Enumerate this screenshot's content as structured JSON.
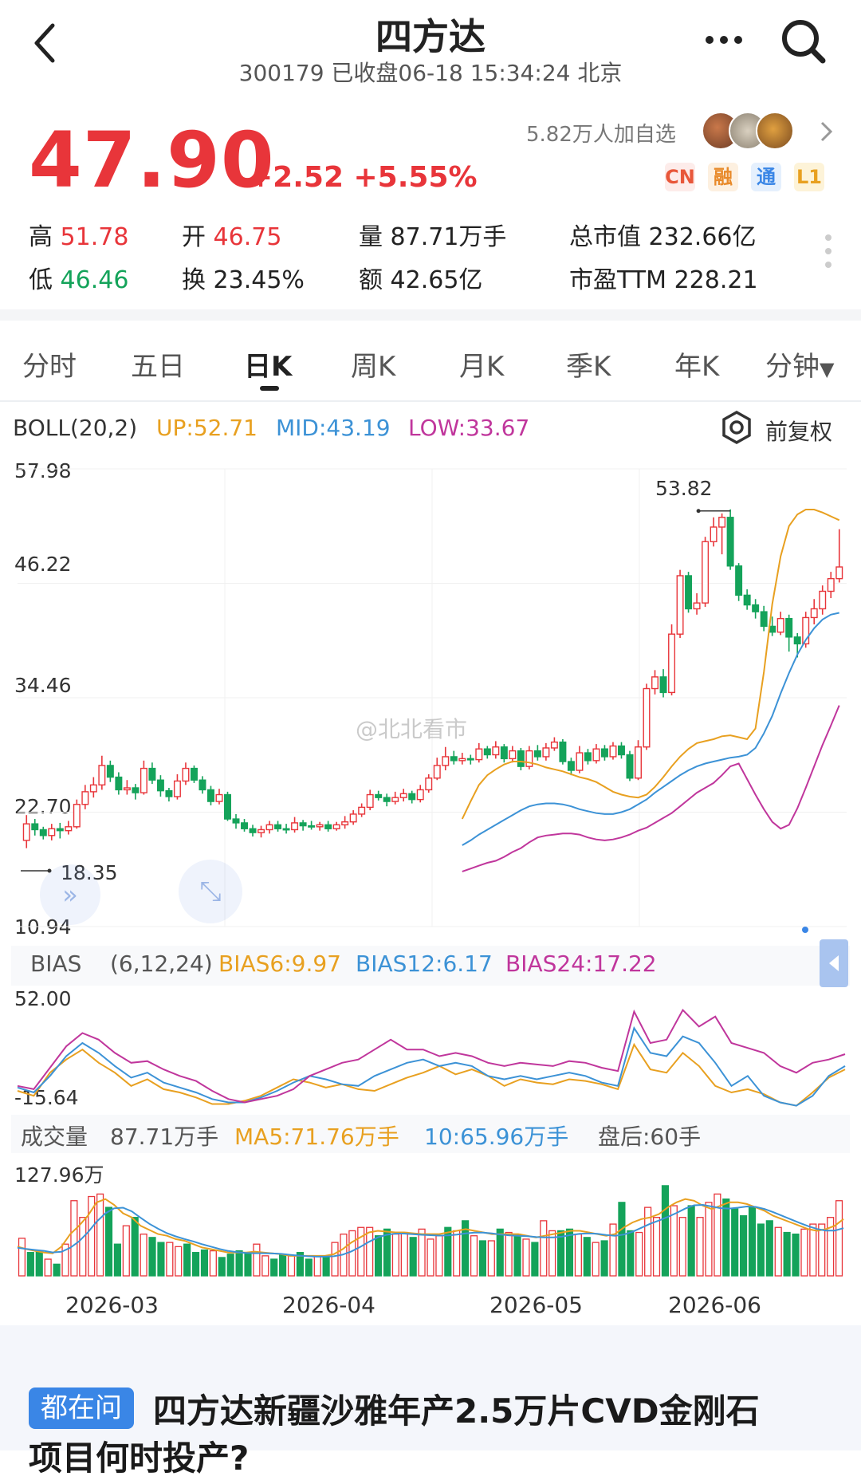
{
  "header": {
    "title": "四方达",
    "subtitle": "300179 已收盘06-18 15:34:24 北京"
  },
  "quote": {
    "price": "47.90",
    "change": "+2.52 +5.55%",
    "followers": "5.82万人加自选",
    "badges": [
      "CN",
      "融",
      "通",
      "L1"
    ],
    "stats": {
      "high_label": "高",
      "high": "51.78",
      "low_label": "低",
      "low": "46.46",
      "open_label": "开",
      "open": "46.75",
      "turnover_label": "换",
      "turnover": "23.45%",
      "volume_label": "量",
      "volume": "87.71万手",
      "amount_label": "额",
      "amount": "42.65亿",
      "mktcap_label": "总市值",
      "mktcap": "232.66亿",
      "pe_label": "市盈TTM",
      "pe": "228.21"
    }
  },
  "tabs": [
    {
      "label": "分时"
    },
    {
      "label": "五日"
    },
    {
      "label": "日K"
    },
    {
      "label": "周K"
    },
    {
      "label": "月K"
    },
    {
      "label": "季K"
    },
    {
      "label": "年K"
    },
    {
      "label": "分钟"
    }
  ],
  "boll": {
    "name": "BOLL(20,2)",
    "up": "UP:52.71",
    "mid": "MID:43.19",
    "low": "LOW:33.67",
    "adjust": "前复权"
  },
  "price_axis": [
    "57.98",
    "46.22",
    "34.46",
    "22.70",
    "10.94"
  ],
  "markers": {
    "high": "53.82",
    "low": "18.35"
  },
  "watermark": "@北北看市",
  "bias": {
    "name": "BIAS",
    "params": "(6,12,24)",
    "b6": "BIAS6:9.97",
    "b12": "BIAS12:6.17",
    "b24": "BIAS24:17.22",
    "axis_top": "52.00",
    "axis_bottom": "-15.64"
  },
  "volume": {
    "name": "成交量",
    "value": "87.71万手",
    "ma5": "MA5:71.76万手",
    "ma10": "10:65.96万手",
    "after": "盘后:60手",
    "axis_top": "127.96万"
  },
  "dates": [
    "2026-03",
    "2026-04",
    "2026-05",
    "2026-06"
  ],
  "question": {
    "badge": "都在问",
    "line1": "四方达新疆沙雅年产2.5万片CVD金刚石",
    "line2": "项目何时投产?"
  },
  "colors": {
    "up": "#e8353a",
    "down": "#14a35a",
    "upper": "#e8a020",
    "mid": "#3c92d6",
    "lower": "#c0369c"
  },
  "chart_data": {
    "type": "candlestick",
    "title": "",
    "ylim": [
      10.94,
      57.98
    ],
    "x_labels": [
      "2026-03",
      "2026-04",
      "2026-05",
      "2026-06"
    ],
    "candles": [
      [
        19.8,
        21.5,
        19.0,
        22.4
      ],
      [
        21.5,
        20.9,
        20.3,
        22.0
      ],
      [
        20.9,
        20.3,
        19.9,
        21.2
      ],
      [
        20.3,
        21.0,
        19.8,
        21.5
      ],
      [
        21.0,
        20.8,
        20.0,
        21.6
      ],
      [
        20.8,
        21.2,
        20.4,
        21.8
      ],
      [
        21.2,
        23.5,
        21.0,
        24.0
      ],
      [
        23.5,
        24.8,
        23.0,
        25.5
      ],
      [
        24.8,
        25.5,
        24.2,
        26.3
      ],
      [
        25.5,
        27.5,
        25.0,
        28.5
      ],
      [
        27.5,
        26.3,
        25.8,
        28.0
      ],
      [
        26.3,
        25.0,
        24.5,
        26.8
      ],
      [
        25.0,
        25.2,
        24.5,
        26.0
      ],
      [
        25.2,
        24.7,
        24.0,
        25.6
      ],
      [
        24.7,
        27.2,
        24.5,
        28.0
      ],
      [
        27.2,
        26.0,
        25.6,
        27.8
      ],
      [
        26.0,
        24.9,
        24.3,
        26.5
      ],
      [
        24.9,
        24.3,
        23.8,
        25.2
      ],
      [
        24.3,
        25.9,
        24.0,
        26.6
      ],
      [
        25.9,
        27.2,
        25.5,
        27.8
      ],
      [
        27.2,
        26.0,
        25.7,
        27.5
      ],
      [
        26.0,
        25.0,
        24.6,
        26.4
      ],
      [
        25.0,
        23.8,
        23.4,
        25.4
      ],
      [
        23.8,
        24.5,
        23.5,
        25.1
      ],
      [
        24.5,
        22.0,
        21.8,
        24.8
      ],
      [
        22.0,
        21.6,
        21.0,
        22.5
      ],
      [
        21.6,
        21.0,
        20.7,
        22.0
      ],
      [
        21.0,
        20.6,
        20.2,
        21.4
      ],
      [
        20.6,
        20.9,
        20.1,
        21.3
      ],
      [
        20.9,
        21.4,
        20.5,
        21.8
      ],
      [
        21.4,
        21.0,
        20.7,
        21.8
      ],
      [
        21.0,
        20.9,
        20.5,
        21.5
      ],
      [
        20.9,
        21.6,
        20.6,
        22.2
      ],
      [
        21.6,
        21.3,
        20.8,
        21.9
      ],
      [
        21.3,
        21.2,
        20.9,
        21.8
      ],
      [
        21.2,
        21.4,
        20.8,
        21.7
      ],
      [
        21.4,
        21.0,
        20.7,
        21.8
      ],
      [
        21.0,
        21.4,
        20.8,
        21.7
      ],
      [
        21.4,
        21.7,
        21.0,
        22.3
      ],
      [
        21.7,
        22.5,
        21.4,
        22.9
      ],
      [
        22.5,
        23.2,
        22.2,
        23.6
      ],
      [
        23.2,
        24.5,
        22.9,
        25.0
      ],
      [
        24.5,
        24.2,
        23.9,
        24.9
      ],
      [
        24.2,
        23.8,
        23.3,
        24.6
      ],
      [
        23.8,
        24.2,
        23.5,
        24.8
      ],
      [
        24.2,
        24.6,
        23.8,
        25.1
      ],
      [
        24.6,
        24.0,
        23.6,
        24.9
      ],
      [
        24.0,
        25.0,
        23.7,
        25.5
      ],
      [
        25.0,
        26.2,
        24.7,
        26.6
      ],
      [
        26.2,
        27.5,
        26.0,
        28.3
      ],
      [
        27.5,
        28.4,
        27.0,
        29.4
      ],
      [
        28.4,
        28.0,
        27.6,
        29.0
      ],
      [
        28.0,
        28.2,
        27.6,
        28.8
      ],
      [
        28.2,
        28.1,
        27.6,
        28.6
      ],
      [
        28.1,
        29.2,
        27.8,
        29.8
      ],
      [
        29.2,
        28.6,
        28.2,
        29.5
      ],
      [
        28.6,
        29.4,
        28.2,
        30.0
      ],
      [
        29.4,
        28.2,
        27.8,
        29.7
      ],
      [
        28.2,
        29.0,
        27.8,
        29.5
      ],
      [
        29.0,
        27.4,
        27.0,
        29.3
      ],
      [
        27.4,
        29.0,
        27.1,
        29.5
      ],
      [
        29.0,
        28.4,
        28.0,
        29.6
      ],
      [
        28.4,
        29.3,
        28.0,
        29.8
      ],
      [
        29.3,
        29.9,
        29.0,
        30.4
      ],
      [
        29.9,
        27.9,
        27.6,
        30.2
      ],
      [
        27.9,
        27.0,
        26.5,
        28.3
      ],
      [
        27.0,
        28.8,
        26.7,
        29.5
      ],
      [
        28.8,
        28.0,
        27.6,
        29.2
      ],
      [
        28.0,
        29.2,
        27.7,
        29.7
      ],
      [
        29.2,
        28.4,
        28.0,
        29.6
      ],
      [
        28.4,
        29.5,
        28.1,
        29.9
      ],
      [
        29.5,
        28.6,
        28.2,
        29.9
      ],
      [
        28.6,
        26.2,
        25.9,
        29.0
      ],
      [
        26.2,
        29.4,
        26.0,
        30.1
      ],
      [
        29.4,
        35.4,
        29.1,
        35.9
      ],
      [
        35.4,
        36.6,
        34.8,
        37.3
      ],
      [
        36.6,
        35.0,
        34.5,
        37.4
      ],
      [
        35.0,
        41.0,
        34.7,
        42.0
      ],
      [
        41.0,
        47.0,
        40.6,
        47.6
      ],
      [
        47.0,
        43.6,
        43.2,
        47.4
      ],
      [
        43.6,
        44.2,
        43.0,
        45.2
      ],
      [
        44.2,
        50.5,
        43.8,
        51.0
      ],
      [
        50.5,
        52.0,
        50.0,
        53.0
      ],
      [
        52.0,
        53.0,
        49.2,
        53.4
      ],
      [
        53.0,
        48.0,
        47.6,
        53.82
      ],
      [
        48.0,
        45.0,
        44.4,
        48.3
      ],
      [
        45.0,
        44.0,
        43.5,
        45.6
      ],
      [
        44.0,
        43.3,
        42.6,
        44.6
      ],
      [
        43.3,
        41.8,
        41.3,
        43.9
      ],
      [
        41.8,
        41.2,
        40.8,
        42.8
      ],
      [
        41.2,
        42.6,
        40.9,
        43.3
      ],
      [
        42.6,
        40.7,
        39.2,
        43.0
      ],
      [
        40.7,
        40.0,
        38.6,
        41.1
      ],
      [
        40.0,
        42.7,
        39.6,
        43.3
      ],
      [
        42.7,
        43.6,
        42.0,
        44.6
      ],
      [
        43.6,
        45.4,
        43.0,
        46.0
      ],
      [
        45.4,
        46.7,
        44.7,
        47.4
      ],
      [
        46.7,
        47.9,
        46.3,
        51.78
      ]
    ],
    "series": [
      {
        "name": "UP",
        "values": [
          22.0,
          23.8,
          25.5,
          26.5,
          27.1,
          27.6,
          27.9,
          27.9,
          27.8,
          27.6,
          27.3,
          27.1,
          26.9,
          26.6,
          26.3,
          26.1,
          25.8,
          25.3,
          24.8,
          24.5,
          24.3,
          24.2,
          24.5,
          25.3,
          26.3,
          27.4,
          28.4,
          29.2,
          29.8,
          30.0,
          30.2,
          30.5,
          30.6,
          30.4,
          30.2,
          31.3,
          37.1,
          44.1,
          49.0,
          52.1,
          53.3,
          53.8,
          53.8,
          53.5,
          53.1,
          52.71
        ]
      },
      {
        "name": "MID",
        "values": [
          19.3,
          19.8,
          20.4,
          20.9,
          21.4,
          21.9,
          22.4,
          22.9,
          23.3,
          23.5,
          23.6,
          23.6,
          23.5,
          23.3,
          23.0,
          22.8,
          22.6,
          22.5,
          22.5,
          22.7,
          23.0,
          23.5,
          24.0,
          24.7,
          25.3,
          25.9,
          26.5,
          27.0,
          27.4,
          27.7,
          27.9,
          28.1,
          28.3,
          28.4,
          28.6,
          29.3,
          30.8,
          32.6,
          34.9,
          37.0,
          38.9,
          40.4,
          41.6,
          42.5,
          43.0,
          43.19
        ]
      },
      {
        "name": "LOW",
        "values": [
          16.6,
          16.9,
          17.2,
          17.5,
          17.7,
          18.1,
          18.6,
          19.0,
          19.6,
          20.1,
          20.3,
          20.4,
          20.5,
          20.5,
          20.4,
          20.1,
          19.9,
          19.8,
          19.9,
          20.1,
          20.4,
          20.8,
          21.1,
          21.6,
          22.1,
          22.6,
          23.3,
          24.0,
          24.7,
          25.2,
          25.7,
          26.5,
          27.4,
          27.7,
          26.1,
          24.5,
          23.0,
          21.7,
          21.0,
          21.4,
          23.1,
          25.2,
          27.4,
          29.6,
          31.6,
          33.67
        ]
      }
    ],
    "bias": {
      "ylim": [
        -15.64,
        52.0
      ],
      "series": [
        {
          "name": "BIAS6",
          "values": [
            -5,
            -8,
            6,
            14,
            20,
            12,
            6,
            -2,
            2,
            -4,
            -6,
            -9,
            -13,
            -13,
            -11,
            -8,
            -3,
            2,
            0,
            -3,
            -1,
            -4,
            -5,
            -1,
            3,
            6,
            10,
            5,
            8,
            4,
            -2,
            2,
            0,
            -1,
            2,
            1,
            -1,
            -4,
            23,
            8,
            6,
            18,
            10,
            -2,
            -6,
            -4,
            -7,
            -12,
            -14,
            -6,
            3,
            8
          ]
        },
        {
          "name": "BIAS12",
          "values": [
            -3,
            -6,
            4,
            16,
            24,
            18,
            10,
            3,
            6,
            0,
            -3,
            -6,
            -10,
            -12,
            -12,
            -9,
            -5,
            0,
            4,
            2,
            -1,
            -2,
            4,
            8,
            12,
            14,
            10,
            12,
            10,
            4,
            2,
            4,
            2,
            4,
            6,
            4,
            0,
            -2,
            33,
            18,
            16,
            28,
            24,
            12,
            -2,
            4,
            -8,
            -12,
            -14,
            -8,
            4,
            10
          ]
        },
        {
          "name": "BIAS24",
          "values": [
            -2,
            -4,
            9,
            22,
            30,
            26,
            18,
            12,
            13,
            8,
            4,
            1,
            -5,
            -10,
            -12,
            -10,
            -8,
            -4,
            4,
            8,
            12,
            14,
            20,
            26,
            20,
            20,
            16,
            18,
            16,
            12,
            10,
            12,
            11,
            10,
            13,
            12,
            9,
            7,
            43,
            24,
            26,
            44,
            34,
            40,
            24,
            21,
            18,
            10,
            6,
            12,
            14,
            17.22
          ]
        }
      ]
    },
    "volume": {
      "ylim": [
        0,
        127.96
      ],
      "values": [
        45,
        28,
        30,
        20,
        14,
        38,
        90,
        70,
        95,
        98,
        82,
        38,
        60,
        70,
        50,
        46,
        40,
        40,
        35,
        38,
        28,
        31,
        30,
        22,
        26,
        30,
        28,
        38,
        24,
        20,
        26,
        24,
        28,
        20,
        24,
        22,
        40,
        50,
        54,
        58,
        58,
        48,
        56,
        50,
        52,
        46,
        56,
        44,
        48,
        58,
        54,
        66,
        48,
        42,
        42,
        56,
        52,
        50,
        44,
        40,
        66,
        54,
        54,
        56,
        50,
        46,
        40,
        42,
        62,
        88,
        54,
        52,
        82,
        70,
        108,
        84,
        70,
        84,
        70,
        88,
        98,
        92,
        80,
        72,
        82,
        62,
        66,
        58,
        52,
        50,
        56,
        62,
        62,
        70,
        90
      ],
      "ma5": [
        35,
        32,
        30,
        28,
        27,
        35,
        50,
        60,
        72,
        88,
        92,
        85,
        75,
        70,
        60,
        55,
        50,
        48,
        44,
        42,
        38,
        34,
        32,
        30,
        28,
        28,
        28,
        29,
        28,
        27,
        26,
        24,
        24,
        24,
        24,
        24,
        26,
        32,
        40,
        46,
        52,
        54,
        53,
        52,
        52,
        51,
        50,
        50,
        50,
        52,
        54,
        56,
        54,
        52,
        50,
        50,
        50,
        50,
        48,
        46,
        48,
        50,
        52,
        54,
        54,
        52,
        50,
        48,
        50,
        58,
        64,
        68,
        70,
        74,
        82,
        88,
        92,
        90,
        84,
        80,
        84,
        88,
        88,
        86,
        82,
        78,
        72,
        68,
        64,
        60,
        56,
        54,
        56,
        60,
        68
      ]
    }
  }
}
